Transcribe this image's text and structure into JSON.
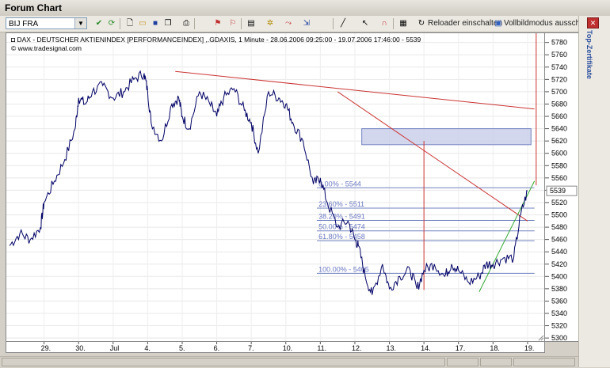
{
  "window": {
    "title": "Forum Chart"
  },
  "toolbar": {
    "symbol": "BIJ FRA",
    "reloader_label": "Reloader einschalten",
    "fullscreen_label": "Vollbildmodus ausschalten"
  },
  "side_tab": {
    "label": "Top-Zertifikate"
  },
  "chart_info": {
    "title": "DAX - DEUTSCHER AKTIENINDEX [PERFORMANCEINDEX] ,.GDAXIS, 1 Minute - 28.06.2006 09:25:00 - 19.07.2006 17:46:00 - 5539",
    "source": "www.tradesignal.com",
    "last_price": "5539"
  },
  "colors": {
    "price_line": "#000066",
    "trend_line": "#cc3333",
    "support_line": "#33aa33",
    "zone_fill": "#c8cde8",
    "fib_line": "#7080c0",
    "fib_text": "#6a78c0"
  },
  "chart_data": {
    "type": "line",
    "title": "DAX - DEUTSCHER AKTIENINDEX [PERFORMANCEINDEX] ,.GDAXIS, 1 Minute - 28.06.2006 09:25:00 - 19.07.2006 17:46:00 - 5539",
    "x_tick_labels": [
      "29.",
      "30.",
      "Jul",
      "4.",
      "5.",
      "6.",
      "7.",
      "10.",
      "11.",
      "12.",
      "13.",
      "14.",
      "17.",
      "18.",
      "19."
    ],
    "y_ticks": [
      5300,
      5320,
      5340,
      5360,
      5380,
      5400,
      5420,
      5440,
      5460,
      5480,
      5500,
      5520,
      5540,
      5560,
      5580,
      5600,
      5620,
      5640,
      5660,
      5680,
      5700,
      5720,
      5740,
      5760,
      5780
    ],
    "ylim": [
      5295,
      5795
    ],
    "series": [
      {
        "x": [
          0,
          0.3,
          0.6,
          0.9,
          1.0,
          1.3,
          1.6,
          1.9,
          2.0,
          2.2,
          2.4,
          2.7,
          3.0,
          3.3,
          3.6,
          3.9,
          4.0,
          4.1,
          4.4,
          4.7,
          4.9,
          5.0,
          5.2,
          5.5,
          5.8,
          6.0,
          6.2,
          6.5,
          6.8,
          7.0,
          7.2,
          7.5,
          7.8,
          8.0,
          8.2,
          8.5,
          8.8,
          9.0,
          9.2,
          9.5,
          9.8,
          10.0,
          10.1,
          10.3,
          10.5,
          10.8,
          11.0,
          11.3,
          11.6,
          11.8,
          12.0,
          12.3,
          12.6,
          12.8,
          13.0,
          13.3,
          13.6,
          13.8,
          14.0,
          14.3,
          14.6,
          14.8,
          15.0
        ],
        "y": [
          5450,
          5470,
          5460,
          5480,
          5520,
          5555,
          5590,
          5640,
          5690,
          5680,
          5700,
          5710,
          5690,
          5700,
          5720,
          5730,
          5700,
          5650,
          5620,
          5680,
          5690,
          5660,
          5640,
          5700,
          5680,
          5660,
          5690,
          5705,
          5670,
          5650,
          5600,
          5700,
          5690,
          5680,
          5650,
          5620,
          5550,
          5560,
          5520,
          5480,
          5490,
          5460,
          5450,
          5400,
          5370,
          5420,
          5380,
          5400,
          5410,
          5380,
          5410,
          5420,
          5400,
          5420,
          5410,
          5390,
          5400,
          5420,
          5420,
          5430,
          5430,
          5500,
          5539
        ]
      }
    ],
    "fibonacci": [
      {
        "label": "0.00% - 5544",
        "value": 5544
      },
      {
        "label": "23.60% - 5511",
        "value": 5511
      },
      {
        "label": "38.20% - 5491",
        "value": 5491
      },
      {
        "label": "50.00% - 5474",
        "value": 5474
      },
      {
        "label": "61.80% - 5458",
        "value": 5458
      },
      {
        "label": "100.00% - 5405",
        "value": 5405
      }
    ],
    "zone": {
      "low": 5614,
      "high": 5640
    },
    "grid": true,
    "y_axis_position": "right"
  }
}
